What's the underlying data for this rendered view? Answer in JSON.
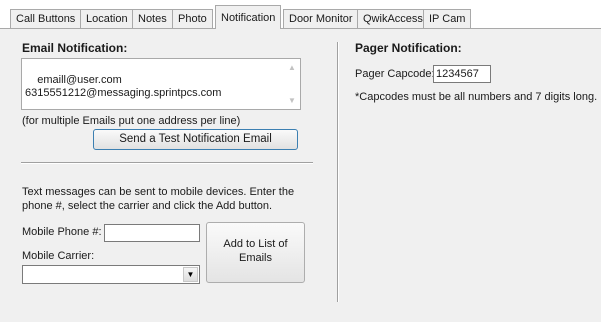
{
  "tabs": [
    {
      "label": "Call Buttons",
      "active": false
    },
    {
      "label": "Location",
      "active": false
    },
    {
      "label": "Notes",
      "active": false
    },
    {
      "label": "Photo",
      "active": false
    },
    {
      "label": "Notification",
      "active": true
    },
    {
      "label": "Door Monitor",
      "active": false
    },
    {
      "label": "QwikAccess",
      "active": false
    },
    {
      "label": "IP Cam",
      "active": false
    }
  ],
  "email": {
    "heading": "Email Notification:",
    "addresses": "emaill@user.com\n6315551212@messaging.sprintpcs.com",
    "hint": "(for multiple Emails put one address per line)",
    "test_button": "Send a Test Notification Email"
  },
  "sms": {
    "instructions": "Text messages can be sent to mobile devices. Enter the phone #, select the carrier and click the Add button.",
    "phone_label": "Mobile Phone #:",
    "phone_value": "",
    "carrier_label": "Mobile Carrier:",
    "carrier_value": "",
    "add_button": "Add to List of Emails"
  },
  "pager": {
    "heading": "Pager Notification:",
    "capcode_label": "Pager Capcode:",
    "capcode_value": "1234567",
    "note": "*Capcodes must be all numbers and 7 digits long."
  },
  "colors": {
    "focus_border": "#3c7fb1",
    "panel_bg": "#f0f0f0"
  }
}
